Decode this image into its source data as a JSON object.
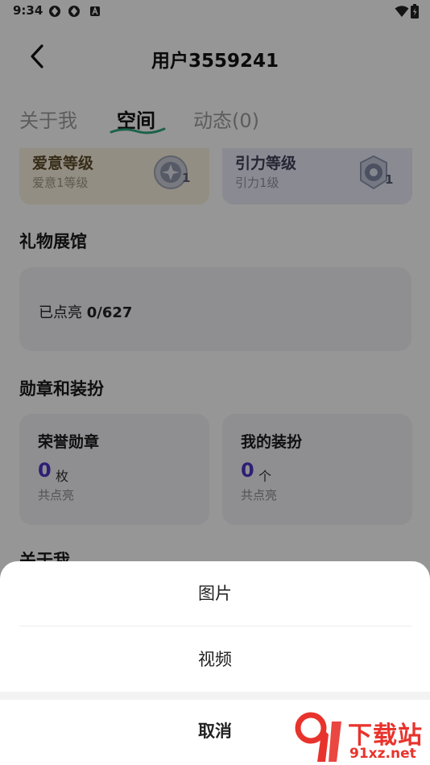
{
  "status_bar": {
    "time": "9:34"
  },
  "header": {
    "title": "用户3559241"
  },
  "tabs": [
    {
      "label": "关于我"
    },
    {
      "label": "空间"
    },
    {
      "label": "动态(0)"
    }
  ],
  "level_cards": [
    {
      "name": "爱意等级",
      "sub": "爱意1等级",
      "level": "1"
    },
    {
      "name": "引力等级",
      "sub": "引力1级",
      "level": "1"
    }
  ],
  "gift_section": {
    "title": "礼物展馆",
    "lit_label": "已点亮 ",
    "lit_value": "0/627"
  },
  "badge_section": {
    "title": "勋章和装扮",
    "cards": [
      {
        "title": "荣誉勋章",
        "count": "0",
        "unit": "枚",
        "foot": "共点亮"
      },
      {
        "title": "我的装扮",
        "count": "0",
        "unit": "个",
        "foot": "共点亮"
      }
    ]
  },
  "about_section": {
    "title": "关于我"
  },
  "action_sheet": {
    "options": [
      "图片",
      "视频"
    ],
    "cancel": "取消"
  },
  "watermark": {
    "cn": "下载站",
    "en": "91xz.net"
  },
  "colors": {
    "accent": "#4b35c4",
    "tab_underline": "#2fa37a",
    "watermark": "#e8332c"
  }
}
